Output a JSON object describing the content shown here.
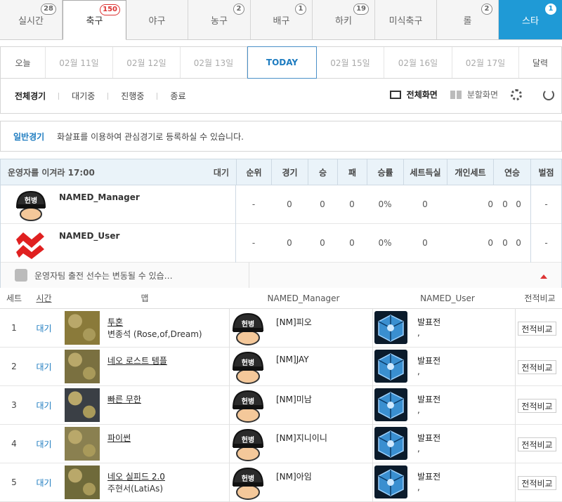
{
  "sport_tabs": [
    {
      "label": "실시간",
      "badge": "28"
    },
    {
      "label": "축구",
      "badge": "150"
    },
    {
      "label": "야구",
      "badge": ""
    },
    {
      "label": "농구",
      "badge": "2"
    },
    {
      "label": "배구",
      "badge": "1"
    },
    {
      "label": "하키",
      "badge": "19"
    },
    {
      "label": "미식축구",
      "badge": ""
    },
    {
      "label": "롤",
      "badge": "2"
    },
    {
      "label": "스타",
      "badge": "1"
    }
  ],
  "dates": {
    "prev": "오늘",
    "d1": "02월 11일",
    "d2": "02월 12일",
    "d3": "02월 13일",
    "today": "TODAY",
    "d5": "02월 15일",
    "d6": "02월 16일",
    "d7": "02월 17일",
    "calendar": "달력"
  },
  "filters": {
    "all": "전체경기",
    "waiting": "대기중",
    "live": "진행중",
    "done": "종료",
    "fullscreen": "전체화면",
    "split": "분할화면"
  },
  "info": {
    "label": "일반경기",
    "text": "화살표를 이용하여 관심경기로 등록하실 수 있습니다."
  },
  "match": {
    "title": "운영자를 이겨라  17:00",
    "status": "대기",
    "headers": [
      "순위",
      "경기",
      "승",
      "패",
      "승률",
      "세트득실",
      "개인세트",
      "연승",
      "벌점"
    ],
    "teams": [
      {
        "name": "NAMED_Manager",
        "rank": "-",
        "games": "0",
        "win": "0",
        "loss": "0",
        "rate": "0%",
        "setdiff": "0",
        "pset": "0",
        "streak": "0   0",
        "penalty": "-"
      },
      {
        "name": "NAMED_User",
        "rank": "-",
        "games": "0",
        "win": "0",
        "loss": "0",
        "rate": "0%",
        "setdiff": "0",
        "pset": "0",
        "streak": "0   0",
        "penalty": "-"
      }
    ],
    "note": "운영자팀 출전 선수는 변동될 수 있습…"
  },
  "sets": {
    "headers": {
      "set": "세트",
      "time": "시간",
      "map": "맵",
      "p1": "NAMED_Manager",
      "p2": "NAMED_User",
      "compare": "전적비교"
    },
    "rows": [
      {
        "no": "1",
        "time": "대기",
        "map": "투혼",
        "sub": "변종석 (Rose,of,Dream)",
        "p1": "[NM]피오",
        "p2": "발표전",
        "p2sub": ",",
        "btn": "전적비교",
        "mapcolor": "#8a7a3a"
      },
      {
        "no": "2",
        "time": "대기",
        "map": "네오 로스트 템플",
        "sub": "",
        "p1": "[NM]JAY",
        "p2": "발표전",
        "p2sub": ",",
        "btn": "전적비교",
        "mapcolor": "#7a7040"
      },
      {
        "no": "3",
        "time": "대기",
        "map": "빠른 무한",
        "sub": "",
        "p1": "[NM]미남",
        "p2": "발표전",
        "p2sub": ",",
        "btn": "전적비교",
        "mapcolor": "#3a3f45"
      },
      {
        "no": "4",
        "time": "대기",
        "map": "파이썬",
        "sub": "",
        "p1": "[NM]지니이니",
        "p2": "발표전",
        "p2sub": ",",
        "btn": "전적비교",
        "mapcolor": "#8a8050"
      },
      {
        "no": "5",
        "time": "대기",
        "map": "네오 실피드 2.0",
        "sub": "주현서(LatiAs)",
        "p1": "[NM]아임",
        "p2": "발표전",
        "p2sub": ",",
        "btn": "전적비교",
        "mapcolor": "#6f6a3a"
      }
    ]
  },
  "colors": {
    "accent": "#1f9ad6",
    "link": "#1e7cc0",
    "alert": "#d33333"
  }
}
